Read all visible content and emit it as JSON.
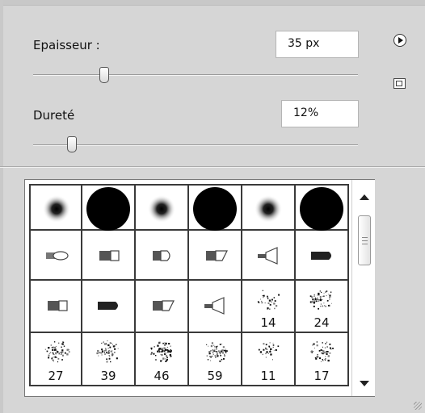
{
  "brush_panel": {
    "thickness": {
      "label": "Epaisseur :",
      "value": "35 px",
      "slider_percent": 22
    },
    "hardness": {
      "label": "Dureté",
      "value": "12%",
      "slider_percent": 12
    },
    "icons": {
      "menu": "panel-menu-icon",
      "new_preset": "new-preset-icon"
    }
  },
  "brushes": [
    {
      "kind": "soft",
      "size": 0.6,
      "label": ""
    },
    {
      "kind": "hard",
      "size": 1.0,
      "label": ""
    },
    {
      "kind": "soft",
      "size": 0.6,
      "label": ""
    },
    {
      "kind": "hard",
      "size": 1.0,
      "label": ""
    },
    {
      "kind": "soft",
      "size": 0.6,
      "label": ""
    },
    {
      "kind": "hard",
      "size": 1.0,
      "label": ""
    },
    {
      "kind": "tip-round",
      "label": ""
    },
    {
      "kind": "tip-flat",
      "label": ""
    },
    {
      "kind": "tip-fan",
      "label": ""
    },
    {
      "kind": "tip-angled",
      "label": ""
    },
    {
      "kind": "tip-cone",
      "label": ""
    },
    {
      "kind": "tip-bullet",
      "label": ""
    },
    {
      "kind": "tip-flat",
      "label": ""
    },
    {
      "kind": "tip-bullet",
      "label": ""
    },
    {
      "kind": "tip-angled",
      "label": ""
    },
    {
      "kind": "tip-cone",
      "label": ""
    },
    {
      "kind": "scatter",
      "density": 0.4,
      "label": "14"
    },
    {
      "kind": "scatter",
      "density": 0.8,
      "label": "24"
    },
    {
      "kind": "scatter",
      "density": 0.9,
      "label": "27"
    },
    {
      "kind": "scatter",
      "density": 0.8,
      "label": "39"
    },
    {
      "kind": "scatter",
      "density": 1.0,
      "label": "46"
    },
    {
      "kind": "scatter",
      "density": 0.9,
      "label": "59"
    },
    {
      "kind": "scatter",
      "density": 0.4,
      "label": "11"
    },
    {
      "kind": "scatter",
      "density": 0.7,
      "label": "17"
    }
  ]
}
